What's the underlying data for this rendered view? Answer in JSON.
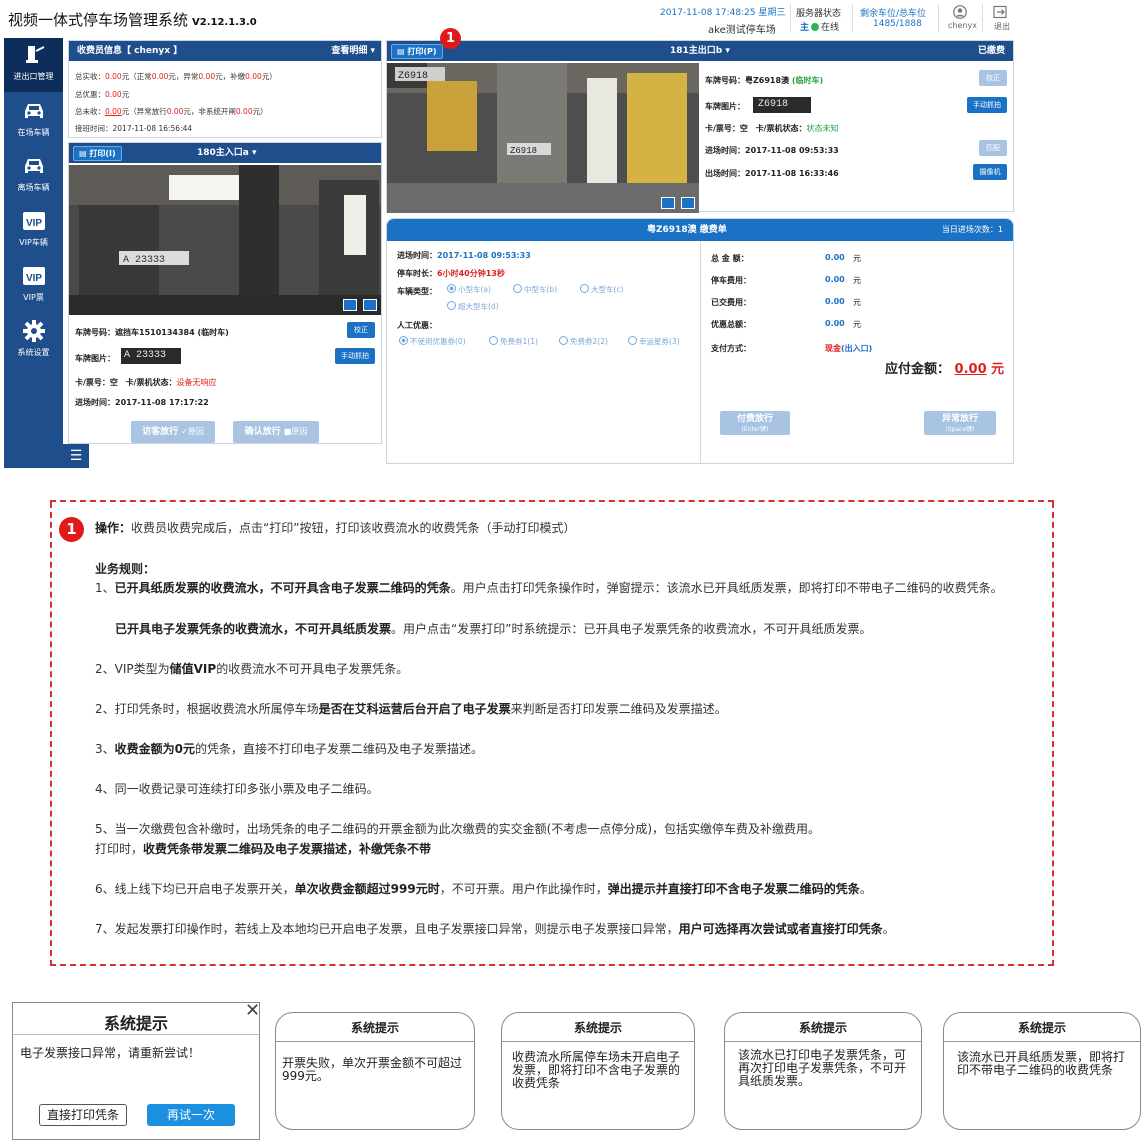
{
  "header": {
    "title": "视频一体式停车场管理系统",
    "version": "V2.12.1.3.0",
    "datetime": "2017-11-08 17:48:25 星期三",
    "lot_name": "ake测试停车场",
    "server_label": "服务器状态",
    "server_role": "主",
    "server_status": "在线",
    "remaining_label": "剩余车位/总车位",
    "remaining_value": "1485/1888",
    "user": "chenyx",
    "exit": "退出"
  },
  "sidebar": {
    "items": [
      {
        "label": "进出口管理",
        "icon": "gate-icon"
      },
      {
        "label": "在场车辆",
        "icon": "car-icon"
      },
      {
        "label": "离场车辆",
        "icon": "car-icon"
      },
      {
        "label": "VIP车辆",
        "icon": "vip-icon"
      },
      {
        "label": "VIP票",
        "icon": "vip-icon"
      },
      {
        "label": "系统设置",
        "icon": "gear-icon"
      }
    ]
  },
  "fee_info": {
    "title": "收费员信息【 chenyx 】",
    "detail_link": "查看明细",
    "line1": {
      "a": "总实收：",
      "v1": "0.00",
      "b": "元（正常",
      "v2": "0.00",
      "c": "元，异常",
      "v3": "0.00",
      "d": "元，补缴",
      "v4": "0.00",
      "e": "元）"
    },
    "line2": {
      "a": "总优惠：",
      "v1": "0.00",
      "b": "元"
    },
    "line3": {
      "a": "总未收：",
      "v1": "0.00",
      "b": "元（异常放行",
      "v2": "0.00",
      "c": "元，非系统开闸",
      "v3": "0.00",
      "d": "元）"
    },
    "line4": "接班时间：2017-11-08 16:56:44"
  },
  "entry": {
    "print_label": "打印(I)",
    "lane": "180主入口a",
    "plate_no_label": "车牌号码：",
    "plate_no": "遮挡车1510134384 (临时车)",
    "correct_btn": "校正",
    "plate_img_label": "车牌图片：",
    "plate_img_text": "A 23333",
    "manual_btn": "手动抓拍",
    "card_label": "卡/票号：空",
    "card_state_label": "卡/票机状态：",
    "card_state": "设备无响应",
    "time_label": "进场时间：2017-11-08 17:17:22",
    "visitor_btn": "访客放行",
    "visitor_reason": "原因",
    "confirm_btn": "确认放行",
    "confirm_reason": "原因"
  },
  "exit": {
    "print_label": "打印(P)",
    "lane": "181主出口b",
    "status": "已缴费",
    "plate_no_label": "车牌号码：",
    "plate_no": "粤Z6918澳",
    "plate_type": "(临时车)",
    "correct_btn": "校正",
    "plate_img_label": "车牌图片：",
    "plate_img_text": "Z6918",
    "manual_btn": "手动抓拍",
    "card_label": "卡/票号：空",
    "card_state_label": "卡/票机状态：",
    "card_state": "状态未知",
    "in_time": "进场时间：2017-11-08 09:53:33",
    "match_btn": "匹配",
    "out_time": "出场时间：2017-11-08 16:33:46",
    "cam_btn": "摄像机"
  },
  "payment": {
    "title": "粤Z6918澳 缴费单",
    "count": "当日进场次数：1",
    "in_time_label": "进场时间：",
    "in_time": "2017-11-08 09:53:33",
    "duration_label": "停车时长：",
    "duration": "6小时40分钟13秒",
    "type_label": "车辆类型：",
    "types": [
      "小型车(a)",
      "中型车(b)",
      "大型车(c)",
      "超大型车(d)"
    ],
    "discount_label": "人工优惠：",
    "discounts": [
      "不使用优惠券(0)",
      "免费券1(1)",
      "免费券2(2)",
      "幸运星券(3)"
    ],
    "rows": [
      {
        "label": "总 金 额：",
        "value": "0.00",
        "unit": "元"
      },
      {
        "label": "停车费用：",
        "value": "0.00",
        "unit": "元"
      },
      {
        "label": "已交费用：",
        "value": "0.00",
        "unit": "元"
      },
      {
        "label": "优惠总额：",
        "value": "0.00",
        "unit": "元"
      }
    ],
    "method_label": "支付方式：",
    "method": "现金",
    "method_suffix": "(出入口)",
    "due_label": "应付金额：",
    "due_value": "0.00",
    "due_unit": "元",
    "pay_btn": "付费放行",
    "pay_key": "(Enter键)",
    "abn_btn": "异常放行",
    "abn_key": "(Space键)"
  },
  "badge": "1",
  "notes": {
    "op_label": "操作：",
    "op_text": "收费员收费完成后，点击“打印”按钮，打印该收费流水的收费凭条（手动打印模式）",
    "rules_title": "业务规则：",
    "r1a": "1、",
    "r1b": "已开具纸质发票的收费流水，不可开具含电子发票二维码的凭条",
    "r1c": "。用户点击打印凭条操作时，弹窗提示：该流水已开具纸质发票，即将打印不带电子二维码的收费凭条。",
    "r1d": "已开具电子发票凭条的收费流水，不可开具纸质发票",
    "r1e": "。用户点击“发票打印”时系统提示：已开具电子发票凭条的收费流水，不可开具纸质发票。",
    "r2a": "2、VIP类型为",
    "r2b": "储值VIP",
    "r2c": "的收费流水不可开具电子发票凭条。",
    "r3a": "2、打印凭条时，根据收费流水所属停车场",
    "r3b": "是否在艾科运营后台开启了电子发票",
    "r3c": "来判断是否打印发票二维码及发票描述。",
    "r4a": "3、",
    "r4b": "收费金额为0元",
    "r4c": "的凭条，直接不打印电子发票二维码及电子发票描述。",
    "r5": "4、同一收费记录可连续打印多张小票及电子二维码。",
    "r6a": "5、当一次缴费包含补缴时，出场凭条的电子二维码的开票金额为此次缴费的实交金额(不考虑一点停分成)，包括实缴停车费及补缴费用。",
    "r6b": "打印时，",
    "r6c": "收费凭条带发票二维码及电子发票描述，补缴凭条不带",
    "r7a": "6、线上线下均已开启电子发票开关，",
    "r7b": "单次收费金额超过999元时",
    "r7c": "，不可开票。用户作此操作时，",
    "r7d": "弹出提示并直接打印不含电子发票二维码的凭条",
    "r7e": "。",
    "r8a": "7、发起发票打印操作时，若线上及本地均已开启电子发票，且电子发票接口异常，则提示电子发票接口异常，",
    "r8b": "用户可选择再次尝试或者直接打印凭条",
    "r8c": "。"
  },
  "dialogs": {
    "d0": {
      "title": "系统提示",
      "message": "电子发票接口异常，请重新尝试！",
      "btn1": "直接打印凭条",
      "btn2": "再试一次"
    },
    "d1": {
      "title": "系统提示",
      "message": "开票失败，单次开票金额不可超过999元。"
    },
    "d2": {
      "title": "系统提示",
      "message": "收费流水所属停车场未开启电子发票，即将打印不含电子发票的收费凭条"
    },
    "d3": {
      "title": "系统提示",
      "message": "该流水已打印电子发票凭条，可再次打印电子发票凭条，不可开具纸质发票。"
    },
    "d4": {
      "title": "系统提示",
      "message": "该流水已开具纸质发票，即将打印不带电子二维码的收费凭条"
    }
  }
}
